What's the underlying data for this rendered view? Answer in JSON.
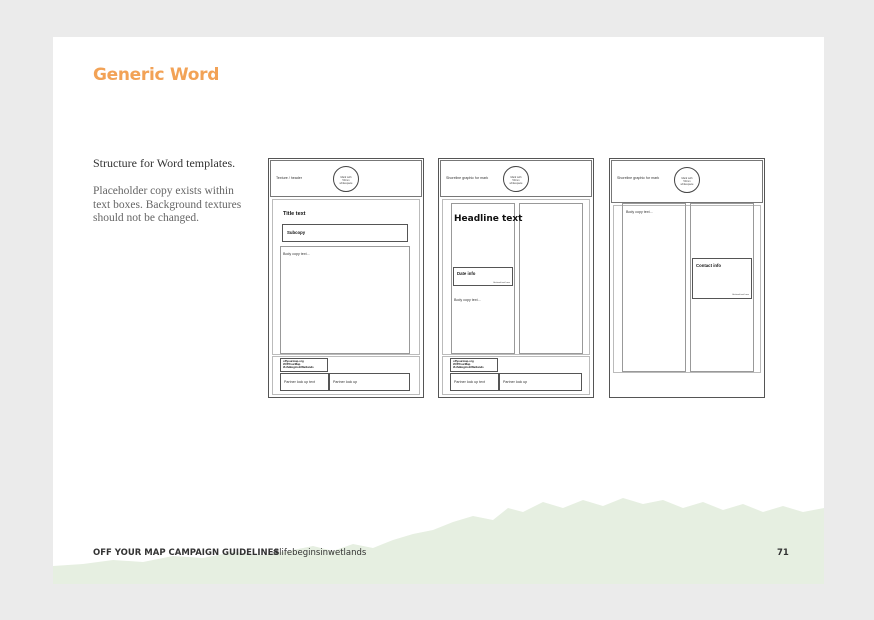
{
  "page": {
    "title": "Generic Word",
    "subhead": "Structure for Word templates.",
    "desc_lines": [
      "Placeholder copy exists within",
      "text boxes. Background textures",
      "should not be changed."
    ]
  },
  "templates": [
    {
      "header_text": "Texture / header",
      "circle_text": "Mark with 50mm whitespace",
      "title_text": "Title text",
      "subcopy": "Subcopy",
      "body_copy": "Body copy text...",
      "footer_lines": [
        "offyourmap.org",
        "#OffYourMap",
        "#LifeBeginsInWetlands"
      ],
      "partner_1": "Partner lock up text",
      "partner_2": "Partner lock up"
    },
    {
      "header_text": "Shoreline graphic for mark",
      "circle_text": "Mark with 50mm whitespace",
      "headline": "Headline text",
      "date_info": "Date info",
      "date_sub": "Unitised text here",
      "body_copy": "Body copy text...",
      "footer_lines": [
        "offyourmap.org",
        "#OffYourMap",
        "#LifeBeginsInWetlands"
      ],
      "partner_1": "Partner lock up text",
      "partner_2": "Partner lock up"
    },
    {
      "header_text": "Shoreline graphic for mark",
      "circle_text": "Mark with 50mm whitespace",
      "body_copy": "Body copy text...",
      "contact_info": "Contact info",
      "contact_sub": "Unitised text here"
    }
  ],
  "footer": {
    "left": "OFF YOUR MAP CAMPAIGN GUIDELINES",
    "hashtag": "#lifebeginsinwetlands",
    "page_number": "71"
  },
  "colors": {
    "title": "#f2a256",
    "landscape": "#e6efe1",
    "background": "#ebebeb"
  }
}
